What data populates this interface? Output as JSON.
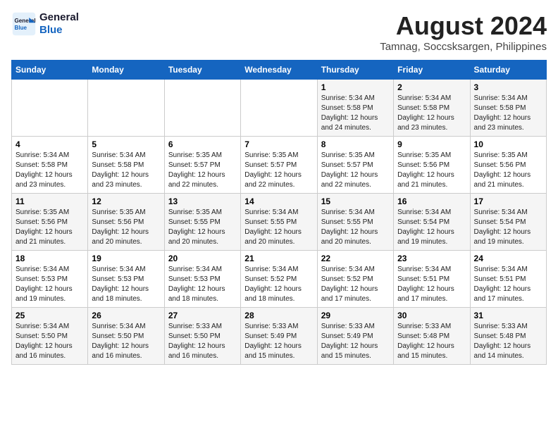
{
  "logo": {
    "line1": "General",
    "line2": "Blue"
  },
  "title": "August 2024",
  "location": "Tamnag, Soccsksargen, Philippines",
  "days_of_week": [
    "Sunday",
    "Monday",
    "Tuesday",
    "Wednesday",
    "Thursday",
    "Friday",
    "Saturday"
  ],
  "weeks": [
    [
      {
        "day": "",
        "info": ""
      },
      {
        "day": "",
        "info": ""
      },
      {
        "day": "",
        "info": ""
      },
      {
        "day": "",
        "info": ""
      },
      {
        "day": "1",
        "sunrise": "5:34 AM",
        "sunset": "5:58 PM",
        "daylight": "12 hours and 24 minutes."
      },
      {
        "day": "2",
        "sunrise": "5:34 AM",
        "sunset": "5:58 PM",
        "daylight": "12 hours and 23 minutes."
      },
      {
        "day": "3",
        "sunrise": "5:34 AM",
        "sunset": "5:58 PM",
        "daylight": "12 hours and 23 minutes."
      }
    ],
    [
      {
        "day": "4",
        "sunrise": "5:34 AM",
        "sunset": "5:58 PM",
        "daylight": "12 hours and 23 minutes."
      },
      {
        "day": "5",
        "sunrise": "5:34 AM",
        "sunset": "5:58 PM",
        "daylight": "12 hours and 23 minutes."
      },
      {
        "day": "6",
        "sunrise": "5:35 AM",
        "sunset": "5:57 PM",
        "daylight": "12 hours and 22 minutes."
      },
      {
        "day": "7",
        "sunrise": "5:35 AM",
        "sunset": "5:57 PM",
        "daylight": "12 hours and 22 minutes."
      },
      {
        "day": "8",
        "sunrise": "5:35 AM",
        "sunset": "5:57 PM",
        "daylight": "12 hours and 22 minutes."
      },
      {
        "day": "9",
        "sunrise": "5:35 AM",
        "sunset": "5:56 PM",
        "daylight": "12 hours and 21 minutes."
      },
      {
        "day": "10",
        "sunrise": "5:35 AM",
        "sunset": "5:56 PM",
        "daylight": "12 hours and 21 minutes."
      }
    ],
    [
      {
        "day": "11",
        "sunrise": "5:35 AM",
        "sunset": "5:56 PM",
        "daylight": "12 hours and 21 minutes."
      },
      {
        "day": "12",
        "sunrise": "5:35 AM",
        "sunset": "5:56 PM",
        "daylight": "12 hours and 20 minutes."
      },
      {
        "day": "13",
        "sunrise": "5:35 AM",
        "sunset": "5:55 PM",
        "daylight": "12 hours and 20 minutes."
      },
      {
        "day": "14",
        "sunrise": "5:34 AM",
        "sunset": "5:55 PM",
        "daylight": "12 hours and 20 minutes."
      },
      {
        "day": "15",
        "sunrise": "5:34 AM",
        "sunset": "5:55 PM",
        "daylight": "12 hours and 20 minutes."
      },
      {
        "day": "16",
        "sunrise": "5:34 AM",
        "sunset": "5:54 PM",
        "daylight": "12 hours and 19 minutes."
      },
      {
        "day": "17",
        "sunrise": "5:34 AM",
        "sunset": "5:54 PM",
        "daylight": "12 hours and 19 minutes."
      }
    ],
    [
      {
        "day": "18",
        "sunrise": "5:34 AM",
        "sunset": "5:53 PM",
        "daylight": "12 hours and 19 minutes."
      },
      {
        "day": "19",
        "sunrise": "5:34 AM",
        "sunset": "5:53 PM",
        "daylight": "12 hours and 18 minutes."
      },
      {
        "day": "20",
        "sunrise": "5:34 AM",
        "sunset": "5:53 PM",
        "daylight": "12 hours and 18 minutes."
      },
      {
        "day": "21",
        "sunrise": "5:34 AM",
        "sunset": "5:52 PM",
        "daylight": "12 hours and 18 minutes."
      },
      {
        "day": "22",
        "sunrise": "5:34 AM",
        "sunset": "5:52 PM",
        "daylight": "12 hours and 17 minutes."
      },
      {
        "day": "23",
        "sunrise": "5:34 AM",
        "sunset": "5:51 PM",
        "daylight": "12 hours and 17 minutes."
      },
      {
        "day": "24",
        "sunrise": "5:34 AM",
        "sunset": "5:51 PM",
        "daylight": "12 hours and 17 minutes."
      }
    ],
    [
      {
        "day": "25",
        "sunrise": "5:34 AM",
        "sunset": "5:50 PM",
        "daylight": "12 hours and 16 minutes."
      },
      {
        "day": "26",
        "sunrise": "5:34 AM",
        "sunset": "5:50 PM",
        "daylight": "12 hours and 16 minutes."
      },
      {
        "day": "27",
        "sunrise": "5:33 AM",
        "sunset": "5:50 PM",
        "daylight": "12 hours and 16 minutes."
      },
      {
        "day": "28",
        "sunrise": "5:33 AM",
        "sunset": "5:49 PM",
        "daylight": "12 hours and 15 minutes."
      },
      {
        "day": "29",
        "sunrise": "5:33 AM",
        "sunset": "5:49 PM",
        "daylight": "12 hours and 15 minutes."
      },
      {
        "day": "30",
        "sunrise": "5:33 AM",
        "sunset": "5:48 PM",
        "daylight": "12 hours and 15 minutes."
      },
      {
        "day": "31",
        "sunrise": "5:33 AM",
        "sunset": "5:48 PM",
        "daylight": "12 hours and 14 minutes."
      }
    ]
  ]
}
